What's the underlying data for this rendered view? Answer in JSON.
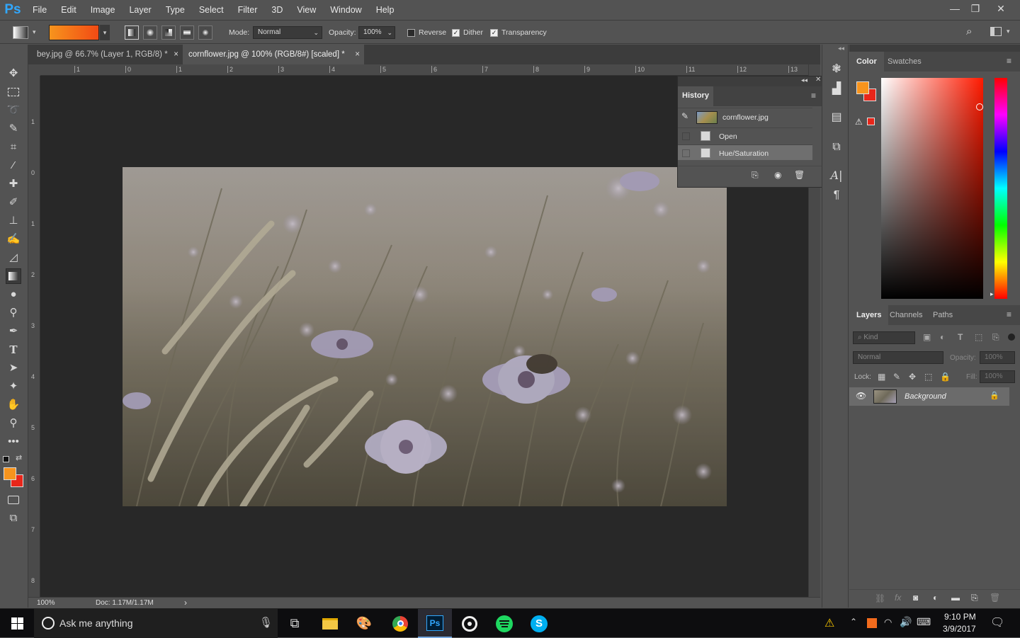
{
  "app": {
    "logo": "Ps"
  },
  "menu": [
    "File",
    "Edit",
    "Image",
    "Layer",
    "Type",
    "Select",
    "Filter",
    "3D",
    "View",
    "Window",
    "Help"
  ],
  "window_controls": {
    "minimize": "—",
    "restore": "❐",
    "close": "✕"
  },
  "options": {
    "mode_label": "Mode:",
    "mode_value": "Normal",
    "opacity_label": "Opacity:",
    "opacity_value": "100%",
    "reverse_label": "Reverse",
    "reverse_checked": false,
    "dither_label": "Dither",
    "dither_checked": true,
    "transparency_label": "Transparency",
    "transparency_checked": true,
    "gradient_colors": [
      "#f7941d",
      "#f24a14"
    ]
  },
  "tabs": [
    {
      "label": "bey.jpg @ 66.7% (Layer 1, RGB/8) *",
      "close": "×",
      "active": false
    },
    {
      "label": "cornflower.jpg @ 100% (RGB/8#) [scaled] *",
      "close": "×",
      "active": true
    }
  ],
  "ruler_top": [
    "1",
    "0",
    "1",
    "2",
    "3",
    "4",
    "5",
    "6",
    "7",
    "8",
    "9",
    "10",
    "11",
    "12",
    "13"
  ],
  "ruler_left": [
    "1",
    "0",
    "1",
    "2",
    "3",
    "4",
    "5",
    "6",
    "7",
    "8"
  ],
  "history": {
    "title": "History",
    "snapshot": "cornflower.jpg",
    "steps": [
      {
        "label": "Open",
        "selected": false
      },
      {
        "label": "Hue/Saturation",
        "selected": true
      }
    ]
  },
  "color_panel": {
    "tabs": [
      "Color",
      "Swatches"
    ],
    "foreground": "#f7941d",
    "background": "#e8261a"
  },
  "layers_panel": {
    "tabs": [
      "Layers",
      "Channels",
      "Paths"
    ],
    "kind_placeholder": "Kind",
    "blend_mode": "Normal",
    "opacity_label": "Opacity:",
    "opacity_value": "100%",
    "lock_label": "Lock:",
    "fill_label": "Fill:",
    "fill_value": "100%",
    "layers": [
      {
        "name": "Background",
        "visible": true,
        "locked": true
      }
    ]
  },
  "status": {
    "zoom": "100%",
    "doc": "Doc: 1.17M/1.17M"
  },
  "taskbar": {
    "search": "Ask me anything",
    "time": "9:10 PM",
    "date": "3/9/2017"
  },
  "icons": {
    "brand": "#31a8ff"
  }
}
